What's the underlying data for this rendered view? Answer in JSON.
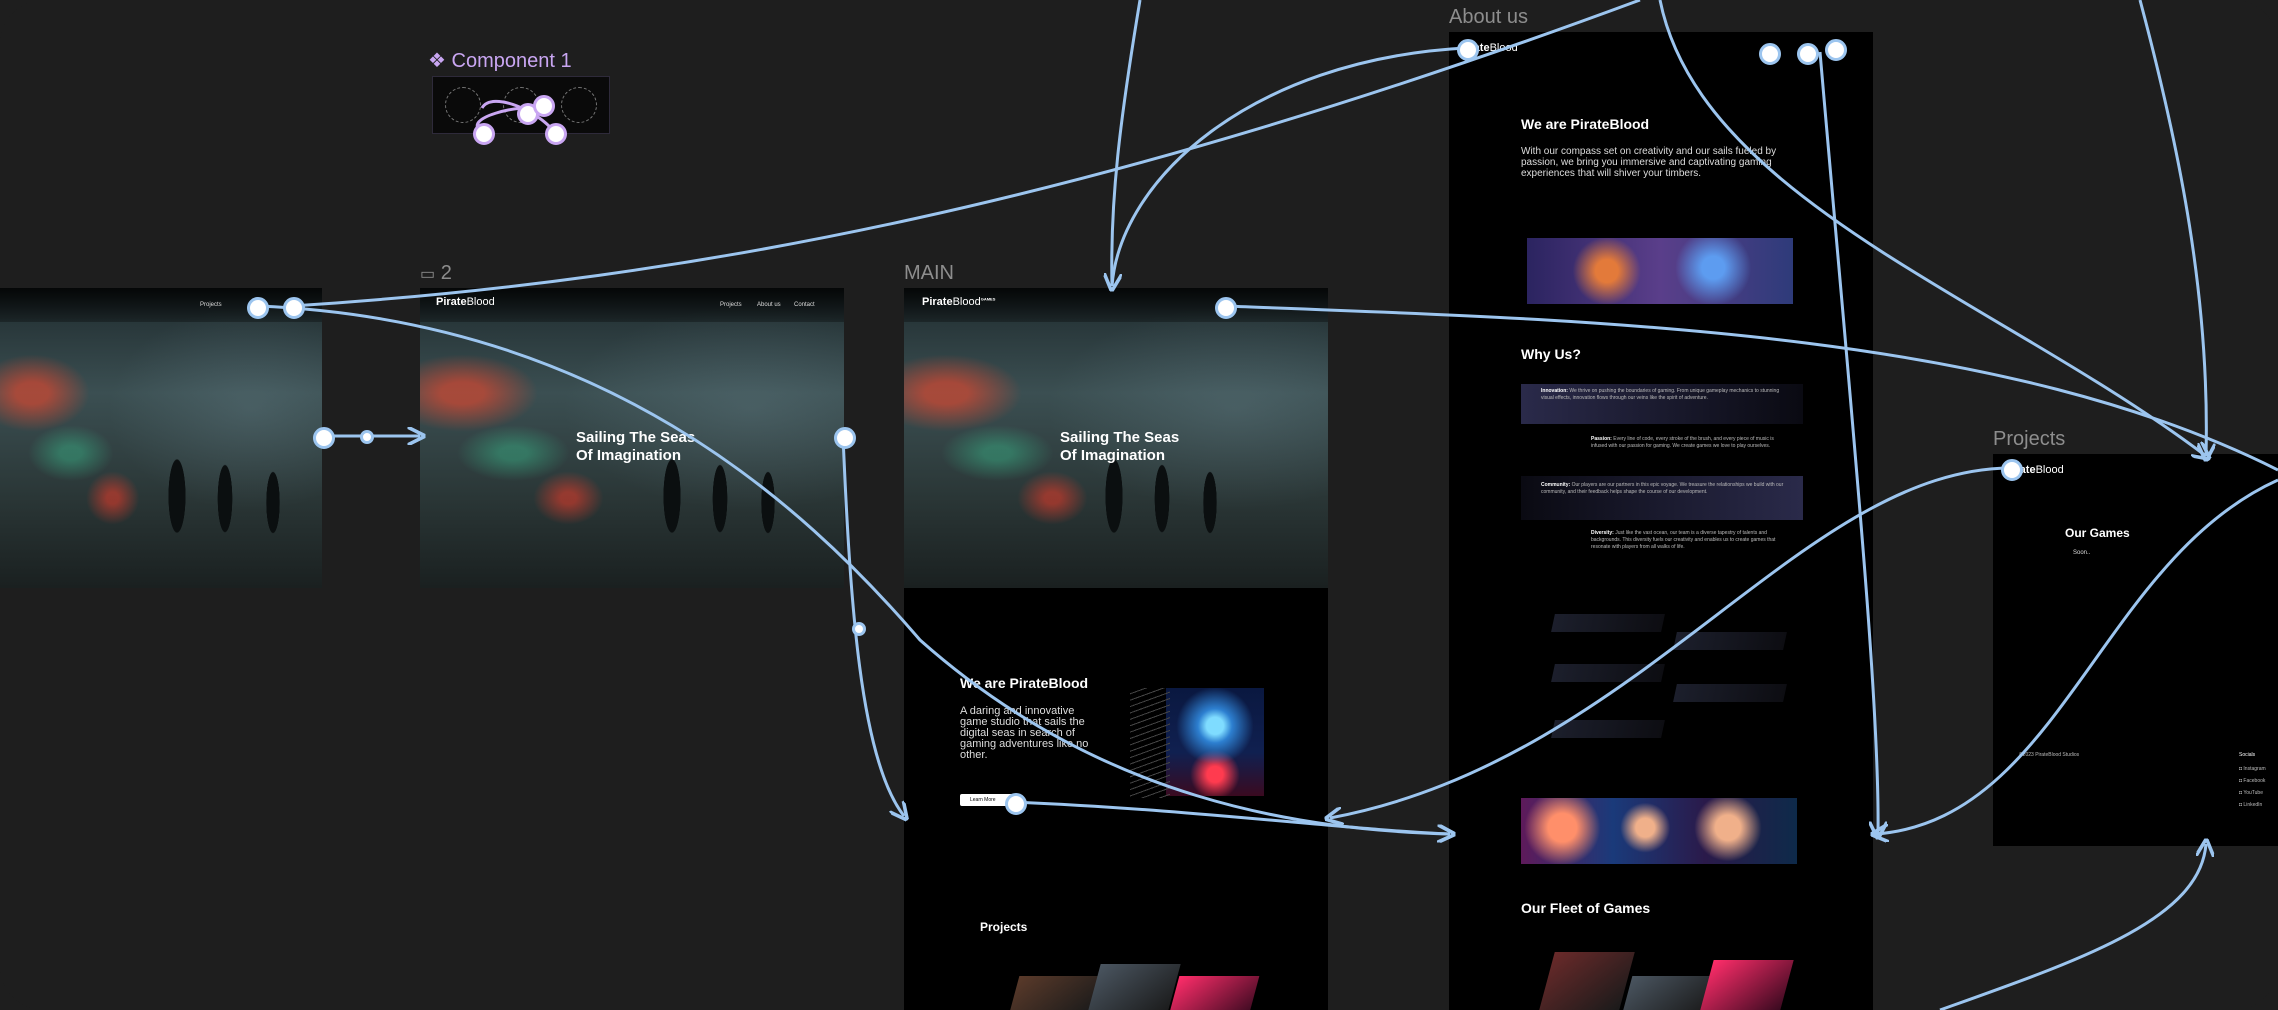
{
  "frames": {
    "component": {
      "label": "Component 1"
    },
    "two": {
      "label": "2"
    },
    "main": {
      "label": "MAIN"
    },
    "about": {
      "label": "About us"
    },
    "projects": {
      "label": "Projects"
    }
  },
  "brand": {
    "logo_bold": "Pirate",
    "logo_regular": "Blood",
    "logo_sup": "GAMES"
  },
  "nav": {
    "projects": "Projects",
    "aboutus": "About us",
    "contact": "Contact"
  },
  "hero": {
    "title_line1": "Sailing The Seas",
    "title_line2": "Of Imagination"
  },
  "main_page": {
    "we_are": "We are PirateBlood",
    "intro": "A daring and innovative game studio that sails the digital seas in search of gaming adventures like no other.",
    "learn_more": "Learn More",
    "projects_heading": "Projects"
  },
  "about_page": {
    "we_are": "We are PirateBlood",
    "intro": "With our compass set on creativity and our sails fueled by passion, we bring you immersive and captivating gaming experiences that will shiver your timbers.",
    "why_us": "Why Us?",
    "why_items": [
      {
        "title": "Innovation:",
        "text": "We thrive on pushing the boundaries of gaming. From unique gameplay mechanics to stunning visual effects, innovation flows through our veins like the spirit of adventure."
      },
      {
        "title": "Passion:",
        "text": "Every line of code, every stroke of the brush, and every piece of music is infused with our passion for gaming. We create games we love to play ourselves."
      },
      {
        "title": "Community:",
        "text": "Our players are our partners in this epic voyage. We treasure the relationships we build with our community, and their feedback helps shape the course of our development."
      },
      {
        "title": "Diversity:",
        "text": "Just like the vast ocean, our team is a diverse tapestry of talents and backgrounds. This diversity fuels our creativity and enables us to create games that resonate with players from all walks of life."
      }
    ],
    "fleet_heading": "Our Fleet of Games"
  },
  "projects_page": {
    "heading": "Our Games",
    "soon": "Soon..",
    "copyright": "©2023 PirateBlood Studios",
    "socials_heading": "Socials",
    "socials": [
      "Instagram",
      "Facebook",
      "YouTube",
      "LinkedIn"
    ]
  },
  "colors": {
    "canvas": "#1e1e1e",
    "connector": "#9cc5ef",
    "component": "#c9a6f2",
    "frame": "#000000"
  }
}
